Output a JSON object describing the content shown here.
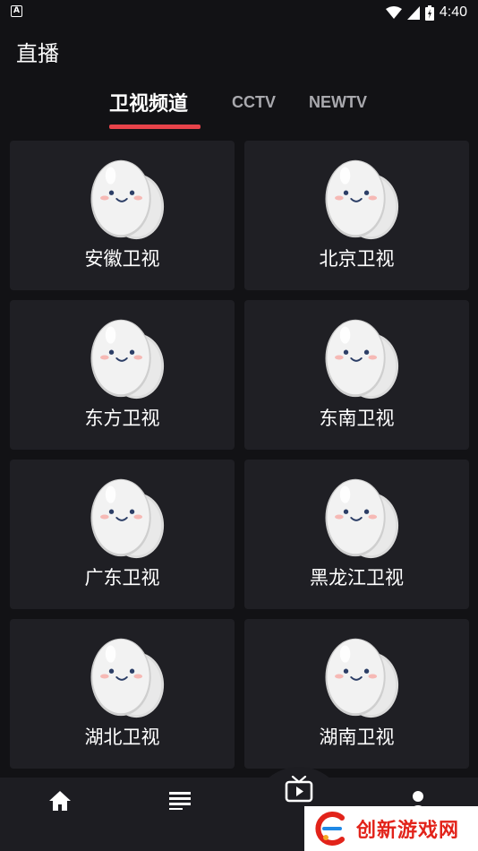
{
  "status_bar": {
    "time": "4:40",
    "notification_icon_label": "A",
    "icons": [
      "wifi-icon",
      "signal-icon",
      "battery-icon"
    ]
  },
  "header": {
    "title": "直播"
  },
  "tabs": [
    {
      "label": "卫视频道",
      "active": true
    },
    {
      "label": "CCTV",
      "active": false
    },
    {
      "label": "NEWTV",
      "active": false
    }
  ],
  "channels": [
    {
      "name": "安徽卫视",
      "icon": "egg-mascot-icon"
    },
    {
      "name": "北京卫视",
      "icon": "egg-mascot-icon"
    },
    {
      "name": "东方卫视",
      "icon": "egg-mascot-icon"
    },
    {
      "name": "东南卫视",
      "icon": "egg-mascot-icon"
    },
    {
      "name": "广东卫视",
      "icon": "egg-mascot-icon"
    },
    {
      "name": "黑龙江卫视",
      "icon": "egg-mascot-icon"
    },
    {
      "name": "湖北卫视",
      "icon": "egg-mascot-icon"
    },
    {
      "name": "湖南卫视",
      "icon": "egg-mascot-icon"
    }
  ],
  "bottom_nav": [
    {
      "icon": "home-icon",
      "active": false
    },
    {
      "icon": "list-icon",
      "active": false
    },
    {
      "icon": "tv-icon",
      "active": true
    },
    {
      "icon": "profile-icon",
      "active": false
    }
  ],
  "watermark": {
    "text": "创新游戏网"
  },
  "colors": {
    "background": "#121215",
    "card": "#1f1f24",
    "accent": "#e8434a",
    "tab_inactive": "#a9a9ae"
  }
}
